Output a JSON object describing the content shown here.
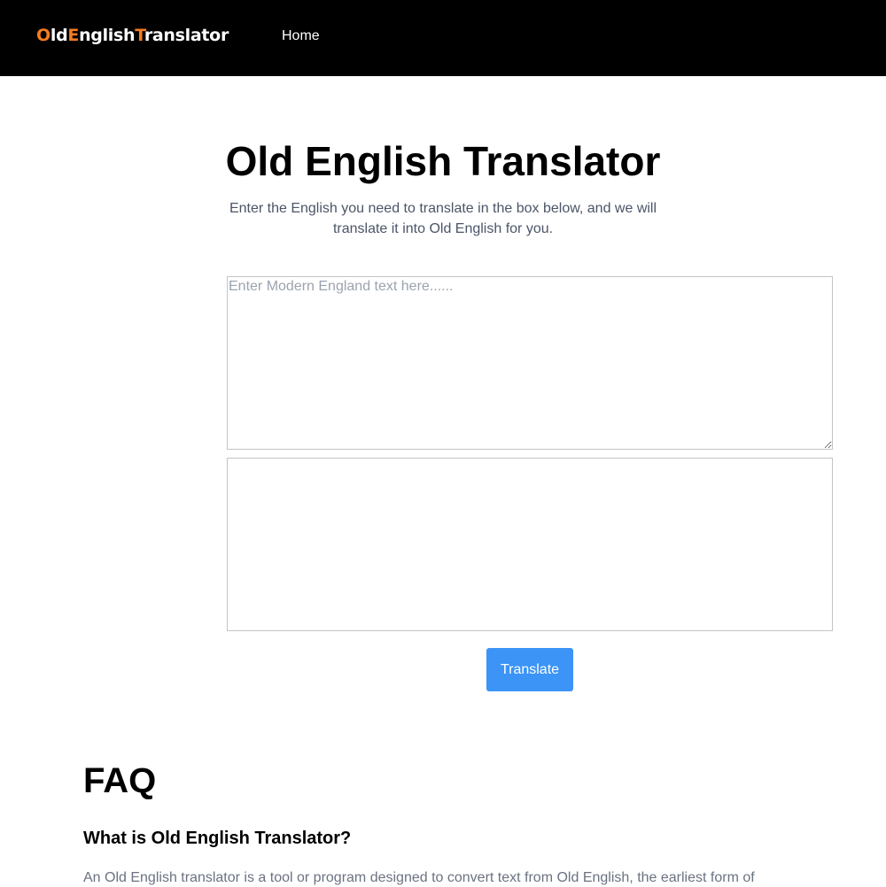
{
  "header": {
    "logo": {
      "part1_accent": "O",
      "part1_rest": "ld",
      "part2_accent": "E",
      "part2_rest": "nglish",
      "part3_accent": "T",
      "part3_rest": "ranslator"
    },
    "nav": [
      {
        "label": "Home"
      }
    ],
    "colors": {
      "background": "#000000",
      "logo_accent": "#f47c20"
    }
  },
  "main": {
    "title": "Old English Translator",
    "subtitle": "Enter the English you need to translate in the box below, and we will translate it into Old English for you.",
    "input": {
      "placeholder": "Enter Modern England text here......",
      "value": ""
    },
    "output": {
      "value": ""
    },
    "translate_button": "Translate",
    "colors": {
      "button": "#3b94f6"
    }
  },
  "faq": {
    "heading": "FAQ",
    "items": [
      {
        "question": "What is Old English Translator?",
        "answer": "An Old English translator is a tool or program designed to convert text from Old English, the earliest form of"
      }
    ]
  }
}
